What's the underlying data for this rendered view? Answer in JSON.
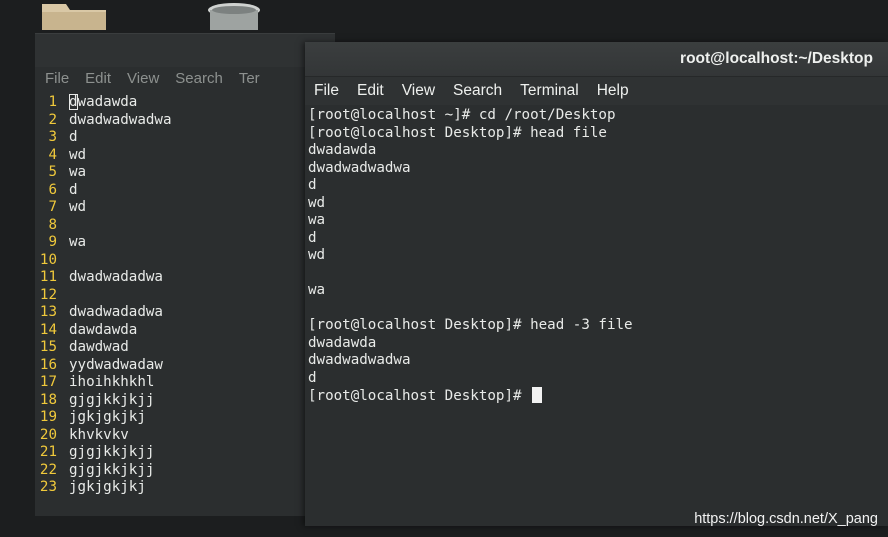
{
  "desktop": {
    "icons": [
      "folder-icon",
      "trash-icon"
    ]
  },
  "editor_window": {
    "menu": [
      "File",
      "Edit",
      "View",
      "Search",
      "Ter"
    ],
    "lines": [
      {
        "num": "1",
        "text": "dwadawda"
      },
      {
        "num": "2",
        "text": "dwadwadwadwa"
      },
      {
        "num": "3",
        "text": "d"
      },
      {
        "num": "4",
        "text": "wd"
      },
      {
        "num": "5",
        "text": "wa"
      },
      {
        "num": "6",
        "text": "d"
      },
      {
        "num": "7",
        "text": "wd"
      },
      {
        "num": "8",
        "text": ""
      },
      {
        "num": "9",
        "text": "wa"
      },
      {
        "num": "10",
        "text": ""
      },
      {
        "num": "11",
        "text": "dwadwadadwa"
      },
      {
        "num": "12",
        "text": ""
      },
      {
        "num": "13",
        "text": "dwadwadadwa"
      },
      {
        "num": "14",
        "text": "dawdawda"
      },
      {
        "num": "15",
        "text": "dawdwad"
      },
      {
        "num": "16",
        "text": "yydwadwadaw"
      },
      {
        "num": "17",
        "text": "ihoihkhkhl"
      },
      {
        "num": "18",
        "text": "gjgjkkjkjj"
      },
      {
        "num": "19",
        "text": "jgkjgkjkj"
      },
      {
        "num": "20",
        "text": "khvkvkv"
      },
      {
        "num": "21",
        "text": "gjgjkkjkjj"
      },
      {
        "num": "22",
        "text": "gjgjkkjkjj"
      },
      {
        "num": "23",
        "text": "jgkjgkjkj"
      }
    ]
  },
  "terminal_window": {
    "title": "root@localhost:~/Desktop",
    "menu": [
      "File",
      "Edit",
      "View",
      "Search",
      "Terminal",
      "Help"
    ],
    "lines": [
      "[root@localhost ~]# cd /root/Desktop",
      "[root@localhost Desktop]# head file",
      "dwadawda",
      "dwadwadwadwa",
      "d",
      "wd",
      "wa",
      "d",
      "wd",
      "",
      "wa",
      "",
      "[root@localhost Desktop]# head -3 file",
      "dwadawda",
      "dwadwadwadwa",
      "d"
    ],
    "prompt": "[root@localhost Desktop]# "
  },
  "watermark": "https://blog.csdn.net/X_pang"
}
